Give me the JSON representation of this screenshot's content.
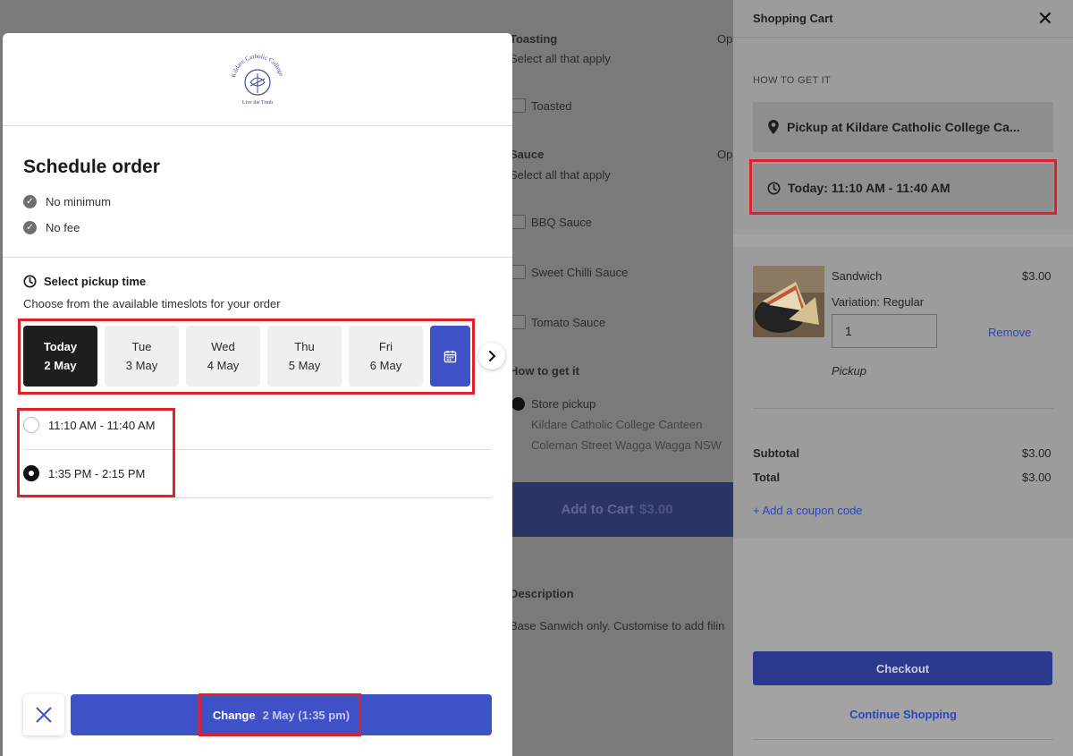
{
  "background": {
    "toasting": {
      "title": "Toasting",
      "optional": "Op",
      "sub": "Select all that apply",
      "option": "Toasted"
    },
    "sauce": {
      "title": "Sauce",
      "optional": "Op",
      "sub": "Select all that apply",
      "options": [
        "BBQ Sauce",
        "Sweet Chilli Sauce",
        "Tomato Sauce"
      ]
    },
    "how_to_get_it": {
      "title": "How to get it",
      "option": "Store pickup",
      "line1": "Kildare Catholic College Canteen",
      "line2": "Coleman Street Wagga Wagga NSW"
    },
    "add_to_cart": {
      "label": "Add to Cart",
      "price": "$3.00"
    },
    "description": {
      "title": "Description",
      "text": "Base Sanwich only. Customise to add filin"
    }
  },
  "cart": {
    "title": "Shopping Cart",
    "section_label": "HOW TO GET IT",
    "pickup_location": "Pickup at Kildare Catholic College Ca...",
    "pickup_time": "Today: 11:10 AM - 11:40 AM",
    "item": {
      "name": "Sandwich",
      "price": "$3.00",
      "variation": "Variation: Regular",
      "quantity": "1",
      "remove": "Remove",
      "method": "Pickup"
    },
    "subtotal_label": "Subtotal",
    "subtotal_value": "$3.00",
    "total_label": "Total",
    "total_value": "$3.00",
    "coupon": "+ Add a coupon code",
    "checkout": "Checkout",
    "continue": "Continue Shopping"
  },
  "modal": {
    "logo_text": "Kildare Catholic College",
    "logo_motto": "Live the Truth",
    "title": "Schedule order",
    "features": [
      "No minimum",
      "No fee"
    ],
    "pickup_heading": "Select pickup time",
    "pickup_sub": "Choose from the available timeslots for your order",
    "days": [
      {
        "day": "Today",
        "date": "2 May",
        "active": true
      },
      {
        "day": "Tue",
        "date": "3 May",
        "active": false
      },
      {
        "day": "Wed",
        "date": "4 May",
        "active": false
      },
      {
        "day": "Thu",
        "date": "5 May",
        "active": false
      },
      {
        "day": "Fri",
        "date": "6 May",
        "active": false
      }
    ],
    "slots": [
      {
        "label": "11:10 AM - 11:40 AM",
        "selected": false
      },
      {
        "label": "1:35 PM - 2:15 PM",
        "selected": true
      }
    ],
    "change_label": "Change",
    "change_value": "2 May (1:35 pm)"
  },
  "colors": {
    "accent": "#3f51c6",
    "highlight": "#e0202a",
    "dark": "#1e1e1e"
  }
}
